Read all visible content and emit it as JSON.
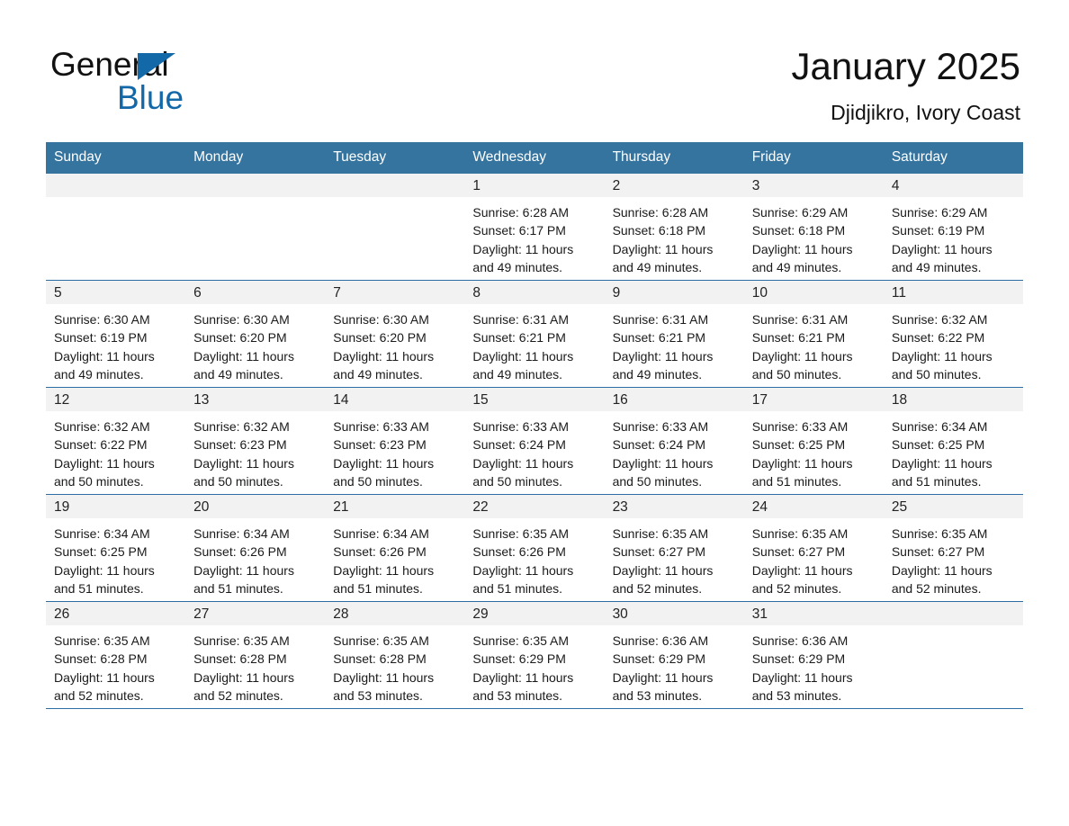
{
  "brand": {
    "name_top": "General",
    "name_bottom": "Blue",
    "accent_color": "#1368a8",
    "triangle_icon": "brand-triangle-icon"
  },
  "header": {
    "title": "January 2025",
    "subtitle": "Djidjikro, Ivory Coast"
  },
  "theme": {
    "header_row_bg": "#35749f",
    "row_divider": "#2e6da4",
    "daynum_band_bg": "#f2f2f2",
    "page_bg": "#ffffff"
  },
  "weekday_headers": [
    "Sunday",
    "Monday",
    "Tuesday",
    "Wednesday",
    "Thursday",
    "Friday",
    "Saturday"
  ],
  "weeks": [
    [
      {
        "day": "",
        "sunrise": "",
        "sunset": "",
        "daylight_1": "",
        "daylight_2": "",
        "empty": true
      },
      {
        "day": "",
        "sunrise": "",
        "sunset": "",
        "daylight_1": "",
        "daylight_2": "",
        "empty": true
      },
      {
        "day": "",
        "sunrise": "",
        "sunset": "",
        "daylight_1": "",
        "daylight_2": "",
        "empty": true
      },
      {
        "day": "1",
        "sunrise": "Sunrise: 6:28 AM",
        "sunset": "Sunset: 6:17 PM",
        "daylight_1": "Daylight: 11 hours",
        "daylight_2": "and 49 minutes."
      },
      {
        "day": "2",
        "sunrise": "Sunrise: 6:28 AM",
        "sunset": "Sunset: 6:18 PM",
        "daylight_1": "Daylight: 11 hours",
        "daylight_2": "and 49 minutes."
      },
      {
        "day": "3",
        "sunrise": "Sunrise: 6:29 AM",
        "sunset": "Sunset: 6:18 PM",
        "daylight_1": "Daylight: 11 hours",
        "daylight_2": "and 49 minutes."
      },
      {
        "day": "4",
        "sunrise": "Sunrise: 6:29 AM",
        "sunset": "Sunset: 6:19 PM",
        "daylight_1": "Daylight: 11 hours",
        "daylight_2": "and 49 minutes."
      }
    ],
    [
      {
        "day": "5",
        "sunrise": "Sunrise: 6:30 AM",
        "sunset": "Sunset: 6:19 PM",
        "daylight_1": "Daylight: 11 hours",
        "daylight_2": "and 49 minutes."
      },
      {
        "day": "6",
        "sunrise": "Sunrise: 6:30 AM",
        "sunset": "Sunset: 6:20 PM",
        "daylight_1": "Daylight: 11 hours",
        "daylight_2": "and 49 minutes."
      },
      {
        "day": "7",
        "sunrise": "Sunrise: 6:30 AM",
        "sunset": "Sunset: 6:20 PM",
        "daylight_1": "Daylight: 11 hours",
        "daylight_2": "and 49 minutes."
      },
      {
        "day": "8",
        "sunrise": "Sunrise: 6:31 AM",
        "sunset": "Sunset: 6:21 PM",
        "daylight_1": "Daylight: 11 hours",
        "daylight_2": "and 49 minutes."
      },
      {
        "day": "9",
        "sunrise": "Sunrise: 6:31 AM",
        "sunset": "Sunset: 6:21 PM",
        "daylight_1": "Daylight: 11 hours",
        "daylight_2": "and 49 minutes."
      },
      {
        "day": "10",
        "sunrise": "Sunrise: 6:31 AM",
        "sunset": "Sunset: 6:21 PM",
        "daylight_1": "Daylight: 11 hours",
        "daylight_2": "and 50 minutes."
      },
      {
        "day": "11",
        "sunrise": "Sunrise: 6:32 AM",
        "sunset": "Sunset: 6:22 PM",
        "daylight_1": "Daylight: 11 hours",
        "daylight_2": "and 50 minutes."
      }
    ],
    [
      {
        "day": "12",
        "sunrise": "Sunrise: 6:32 AM",
        "sunset": "Sunset: 6:22 PM",
        "daylight_1": "Daylight: 11 hours",
        "daylight_2": "and 50 minutes."
      },
      {
        "day": "13",
        "sunrise": "Sunrise: 6:32 AM",
        "sunset": "Sunset: 6:23 PM",
        "daylight_1": "Daylight: 11 hours",
        "daylight_2": "and 50 minutes."
      },
      {
        "day": "14",
        "sunrise": "Sunrise: 6:33 AM",
        "sunset": "Sunset: 6:23 PM",
        "daylight_1": "Daylight: 11 hours",
        "daylight_2": "and 50 minutes."
      },
      {
        "day": "15",
        "sunrise": "Sunrise: 6:33 AM",
        "sunset": "Sunset: 6:24 PM",
        "daylight_1": "Daylight: 11 hours",
        "daylight_2": "and 50 minutes."
      },
      {
        "day": "16",
        "sunrise": "Sunrise: 6:33 AM",
        "sunset": "Sunset: 6:24 PM",
        "daylight_1": "Daylight: 11 hours",
        "daylight_2": "and 50 minutes."
      },
      {
        "day": "17",
        "sunrise": "Sunrise: 6:33 AM",
        "sunset": "Sunset: 6:25 PM",
        "daylight_1": "Daylight: 11 hours",
        "daylight_2": "and 51 minutes."
      },
      {
        "day": "18",
        "sunrise": "Sunrise: 6:34 AM",
        "sunset": "Sunset: 6:25 PM",
        "daylight_1": "Daylight: 11 hours",
        "daylight_2": "and 51 minutes."
      }
    ],
    [
      {
        "day": "19",
        "sunrise": "Sunrise: 6:34 AM",
        "sunset": "Sunset: 6:25 PM",
        "daylight_1": "Daylight: 11 hours",
        "daylight_2": "and 51 minutes."
      },
      {
        "day": "20",
        "sunrise": "Sunrise: 6:34 AM",
        "sunset": "Sunset: 6:26 PM",
        "daylight_1": "Daylight: 11 hours",
        "daylight_2": "and 51 minutes."
      },
      {
        "day": "21",
        "sunrise": "Sunrise: 6:34 AM",
        "sunset": "Sunset: 6:26 PM",
        "daylight_1": "Daylight: 11 hours",
        "daylight_2": "and 51 minutes."
      },
      {
        "day": "22",
        "sunrise": "Sunrise: 6:35 AM",
        "sunset": "Sunset: 6:26 PM",
        "daylight_1": "Daylight: 11 hours",
        "daylight_2": "and 51 minutes."
      },
      {
        "day": "23",
        "sunrise": "Sunrise: 6:35 AM",
        "sunset": "Sunset: 6:27 PM",
        "daylight_1": "Daylight: 11 hours",
        "daylight_2": "and 52 minutes."
      },
      {
        "day": "24",
        "sunrise": "Sunrise: 6:35 AM",
        "sunset": "Sunset: 6:27 PM",
        "daylight_1": "Daylight: 11 hours",
        "daylight_2": "and 52 minutes."
      },
      {
        "day": "25",
        "sunrise": "Sunrise: 6:35 AM",
        "sunset": "Sunset: 6:27 PM",
        "daylight_1": "Daylight: 11 hours",
        "daylight_2": "and 52 minutes."
      }
    ],
    [
      {
        "day": "26",
        "sunrise": "Sunrise: 6:35 AM",
        "sunset": "Sunset: 6:28 PM",
        "daylight_1": "Daylight: 11 hours",
        "daylight_2": "and 52 minutes."
      },
      {
        "day": "27",
        "sunrise": "Sunrise: 6:35 AM",
        "sunset": "Sunset: 6:28 PM",
        "daylight_1": "Daylight: 11 hours",
        "daylight_2": "and 52 minutes."
      },
      {
        "day": "28",
        "sunrise": "Sunrise: 6:35 AM",
        "sunset": "Sunset: 6:28 PM",
        "daylight_1": "Daylight: 11 hours",
        "daylight_2": "and 53 minutes."
      },
      {
        "day": "29",
        "sunrise": "Sunrise: 6:35 AM",
        "sunset": "Sunset: 6:29 PM",
        "daylight_1": "Daylight: 11 hours",
        "daylight_2": "and 53 minutes."
      },
      {
        "day": "30",
        "sunrise": "Sunrise: 6:36 AM",
        "sunset": "Sunset: 6:29 PM",
        "daylight_1": "Daylight: 11 hours",
        "daylight_2": "and 53 minutes."
      },
      {
        "day": "31",
        "sunrise": "Sunrise: 6:36 AM",
        "sunset": "Sunset: 6:29 PM",
        "daylight_1": "Daylight: 11 hours",
        "daylight_2": "and 53 minutes."
      },
      {
        "day": "",
        "sunrise": "",
        "sunset": "",
        "daylight_1": "",
        "daylight_2": "",
        "empty": true
      }
    ]
  ]
}
